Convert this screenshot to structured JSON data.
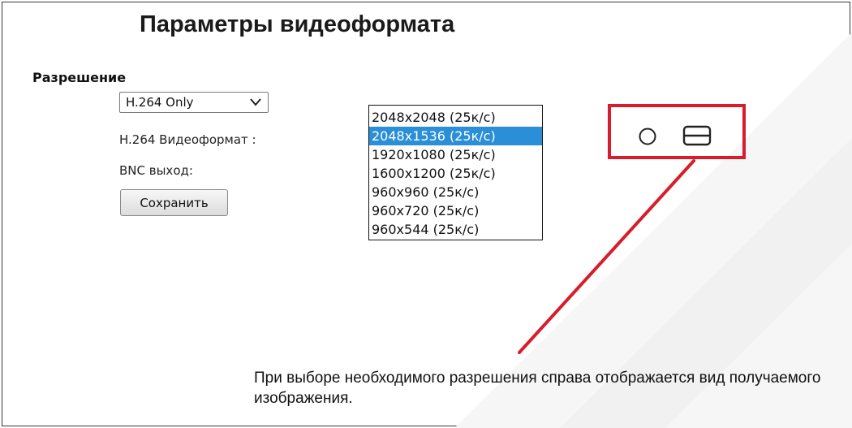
{
  "header": {
    "title": "Параметры видеоформата"
  },
  "form": {
    "section_label": "Разрешение",
    "mode_select": {
      "value": "H.264 Only"
    },
    "videoformat_label": "H.264 Видеоформат :",
    "bnc_label": "BNC выход:",
    "save_label": "Сохранить"
  },
  "resolution_list": {
    "items": [
      "2048x2048 (25к/с)",
      "2048x1536 (25к/с)",
      "1920x1080 (25к/с)",
      "1600x1200 (25к/с)",
      "960x960 (25к/с)",
      "960x720 (25к/с)",
      "960x544 (25к/с)"
    ],
    "selected_index": 1
  },
  "preview": {
    "icons": [
      "circle-icon",
      "split-view-icon"
    ],
    "highlight_color": "#d71d2b"
  },
  "caption": "При выборе необходимого разрешения справа отображается вид получаемого изображения.",
  "colors": {
    "selection": "#2a8fd6",
    "annotation": "#d71d2b"
  }
}
